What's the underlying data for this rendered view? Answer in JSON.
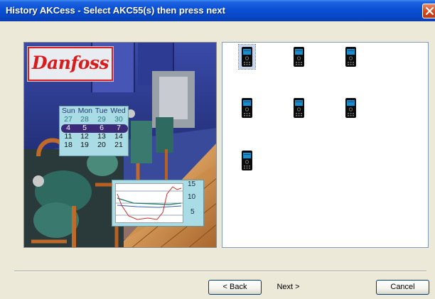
{
  "window": {
    "title": "History AKCess - Select AKC55(s) then press next"
  },
  "logo": {
    "text": "Danfoss"
  },
  "calendar": {
    "header": "Sun Mon Tue Wed",
    "rows": [
      [
        "27",
        "28",
        "29",
        "30"
      ],
      [
        "4",
        "5",
        "6",
        "7"
      ],
      [
        "11",
        "12",
        "13",
        "14"
      ],
      [
        "18",
        "19",
        "20",
        "21"
      ]
    ]
  },
  "minichart": {
    "ticks": [
      "15",
      "10",
      "5"
    ]
  },
  "devices": {
    "icon": "akc55-controller-icon",
    "count": 7,
    "selected_index": 0
  },
  "buttons": {
    "back": "< Back",
    "next": "Next >",
    "cancel": "Cancel"
  },
  "colors": {
    "titlebar": "#0a4fd4",
    "close": "#d6471d",
    "dialog_bg": "#ece9d8",
    "brand_red": "#d81c1c"
  }
}
